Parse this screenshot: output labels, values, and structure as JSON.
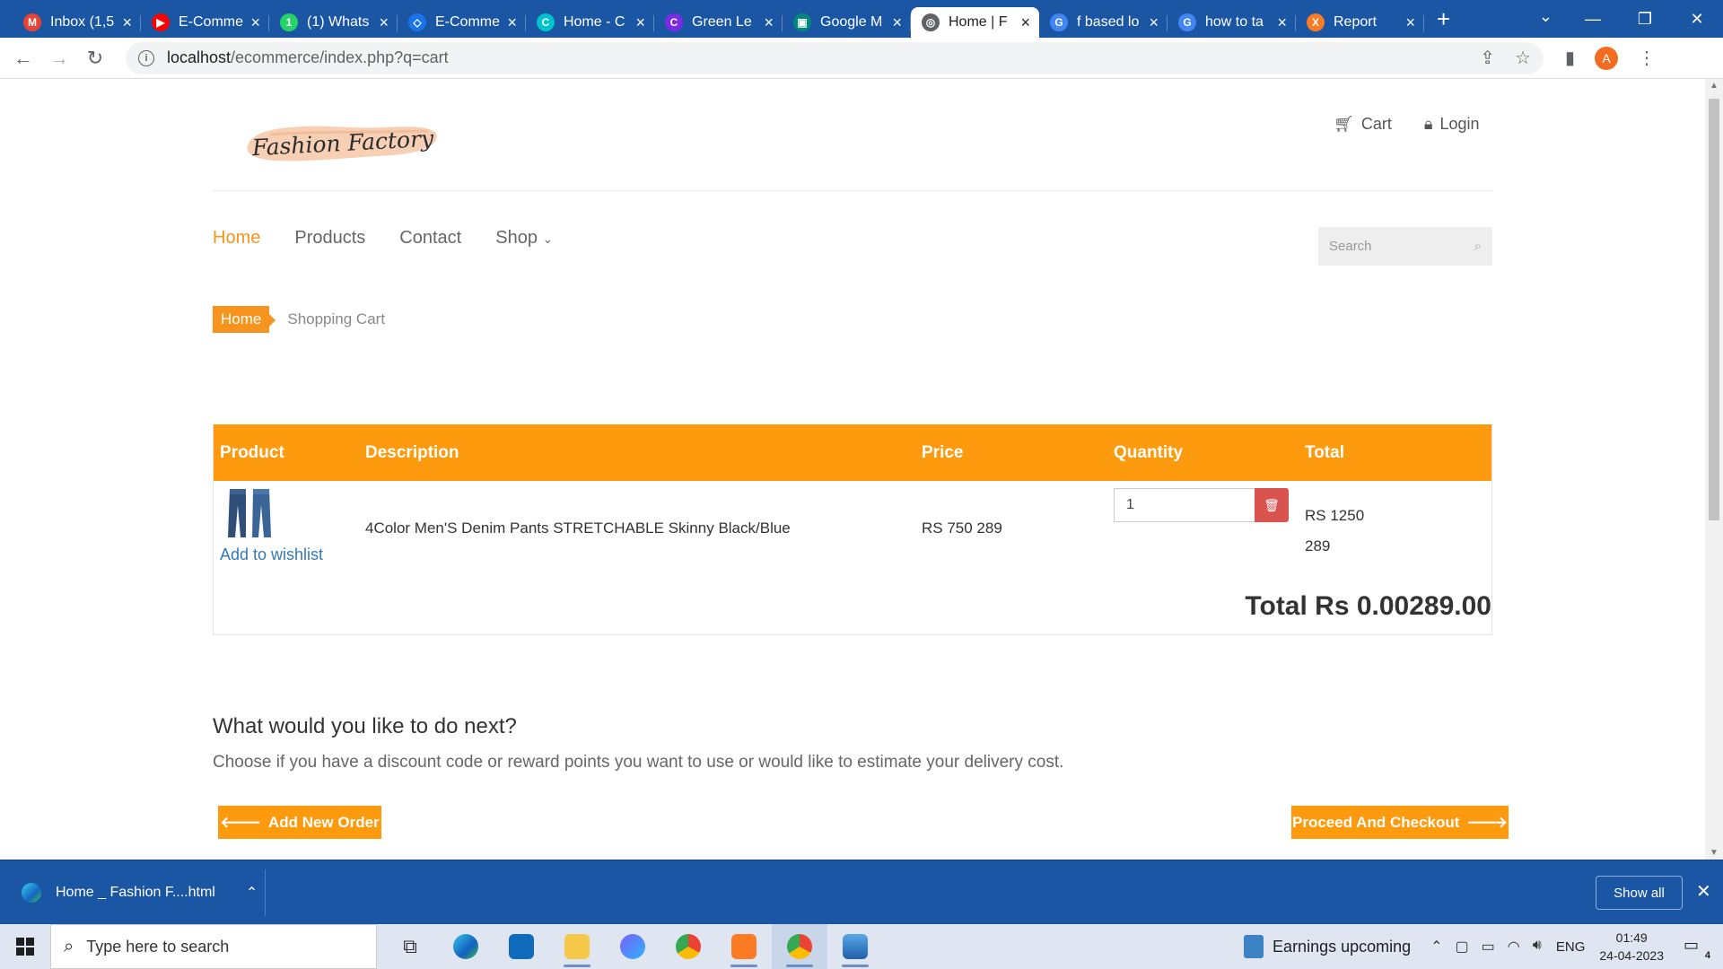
{
  "browser": {
    "tabs": [
      {
        "title": "Inbox (1,5",
        "icon": "gmail-icon",
        "color": "#ea4335",
        "glyph": "M"
      },
      {
        "title": "E-Comme",
        "icon": "youtube-icon",
        "color": "#ff0000",
        "glyph": "▶"
      },
      {
        "title": "(1) Whats",
        "icon": "whatsapp-icon",
        "color": "#25d366",
        "glyph": "1"
      },
      {
        "title": "E-Comme",
        "icon": "drive-icon",
        "color": "#1a73e8",
        "glyph": "◇"
      },
      {
        "title": "Home - C",
        "icon": "canva-icon",
        "color": "#00c4cc",
        "glyph": "C"
      },
      {
        "title": "Green Le",
        "icon": "canva-icon",
        "color": "#7d2ae8",
        "glyph": "C"
      },
      {
        "title": "Google M",
        "icon": "meet-icon",
        "color": "#00897b",
        "glyph": "▣"
      },
      {
        "title": "Home | F",
        "icon": "globe-icon",
        "color": "#5f6368",
        "glyph": "◎",
        "active": true
      },
      {
        "title": "f based lo",
        "icon": "google-icon",
        "color": "#4285f4",
        "glyph": "G"
      },
      {
        "title": "how to ta",
        "icon": "google-icon",
        "color": "#4285f4",
        "glyph": "G"
      },
      {
        "title": "Report",
        "icon": "xampp-icon",
        "color": "#fb7a24",
        "glyph": "X"
      }
    ],
    "url_host": "localhost",
    "url_path": "/ecommerce/index.php?q=cart",
    "profile_initial": "A"
  },
  "site": {
    "logo_text": "Fashion Factory",
    "header_links": [
      "Cart",
      "Login"
    ],
    "nav": [
      {
        "label": "Home",
        "active": true
      },
      {
        "label": "Products"
      },
      {
        "label": "Contact"
      },
      {
        "label": "Shop",
        "dropdown": true
      }
    ],
    "search_placeholder": "Search",
    "breadcrumb": {
      "home": "Home",
      "current": "Shopping Cart"
    }
  },
  "cart": {
    "headers": {
      "product": "Product",
      "description": "Description",
      "price": "Price",
      "quantity": "Quantity",
      "total": "Total"
    },
    "items": [
      {
        "wishlist_label": "Add to wishlist",
        "description": "4Color Men'S Denim Pants STRETCHABLE Skinny Black/Blue",
        "price": "RS 750 289",
        "quantity": "1",
        "total_line1": "RS 1250",
        "total_line2": "289"
      }
    ],
    "grand_total": "Total Rs 0.00289.00"
  },
  "next": {
    "title": "What would you like to do next?",
    "description": "Choose if you have a discount code or reward points you want to use or would like to estimate your delivery cost.",
    "add_order_label": "Add New Order",
    "checkout_label": "Proceed And Checkout"
  },
  "downloads": {
    "file": "Home _ Fashion F....html",
    "show_all": "Show all"
  },
  "taskbar": {
    "search_placeholder": "Type here to search",
    "news": "Earnings upcoming",
    "lang": "ENG",
    "time": "01:49",
    "date": "24-04-2023",
    "notifications": "4"
  }
}
